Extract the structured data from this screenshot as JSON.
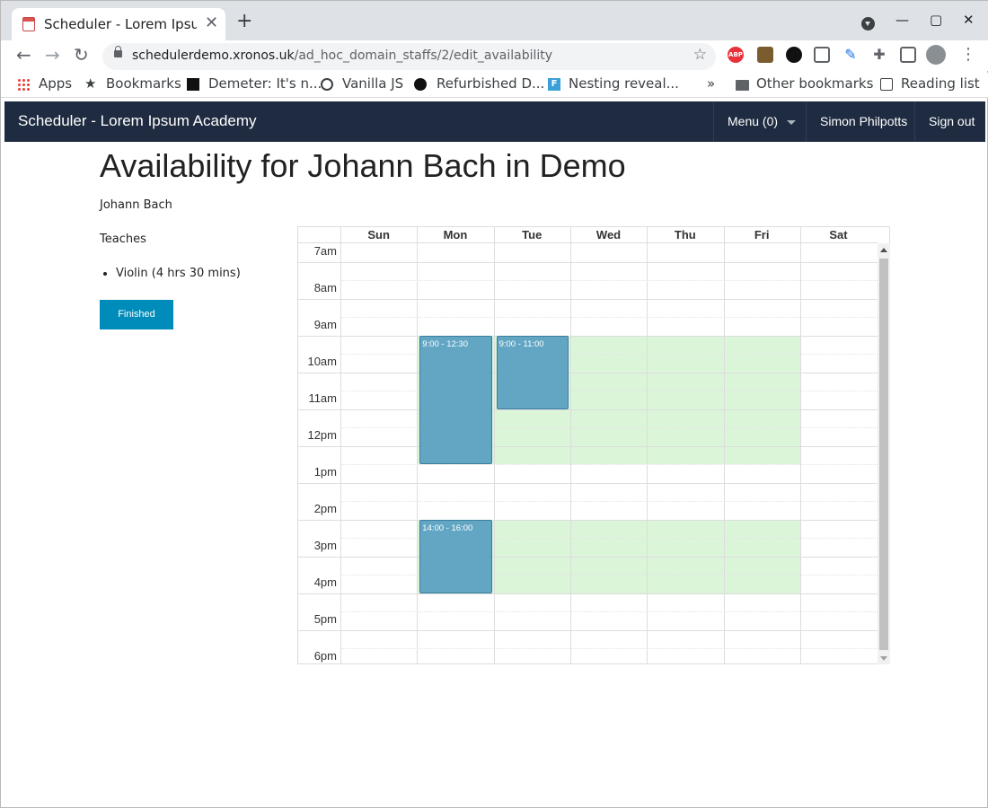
{
  "browser": {
    "tab_title": "Scheduler - Lorem Ipsum Academy",
    "tab_close": "✕",
    "new_tab": "+",
    "url_host": "schedulerdemo.xronos.uk",
    "url_path": "/ad_hoc_domain_staffs/2/edit_availability",
    "bookmarks": {
      "apps": "Apps",
      "bookmarks": "Bookmarks",
      "demeter": "Demeter: It's n...",
      "vanilla": "Vanilla JS",
      "refurbished": "Refurbished D...",
      "nesting": "Nesting reveal...",
      "more": "»",
      "other": "Other bookmarks",
      "reading": "Reading list"
    },
    "extensions": {
      "abp": "ABP"
    }
  },
  "app": {
    "brand": "Scheduler - Lorem Ipsum Academy",
    "menu": "Menu (0)",
    "user": "Simon Philpotts",
    "sign_out": "Sign out",
    "navbar_color": "#1e2b40"
  },
  "page": {
    "title": "Availability for Johann Bach in Demo",
    "staff_name": "Johann Bach",
    "teaches_label": "Teaches",
    "subjects": [
      "Violin (4 hrs 30 mins)"
    ],
    "finished_button": "Finished",
    "button_color": "#008cba"
  },
  "calendar": {
    "days": [
      "Sun",
      "Mon",
      "Tue",
      "Wed",
      "Thu",
      "Fri",
      "Sat"
    ],
    "hours": [
      "7am",
      "8am",
      "9am",
      "10am",
      "11am",
      "12pm",
      "1pm",
      "2pm",
      "3pm",
      "4pm",
      "5pm",
      "6pm"
    ],
    "availability_color": "#dbf5d9",
    "event_color": "#62a6c4",
    "availability": [
      {
        "from_day": "Mon",
        "to_day": "Fri",
        "start": "9:00",
        "end": "12:30"
      },
      {
        "from_day": "Mon",
        "to_day": "Fri",
        "start": "14:00",
        "end": "16:00"
      }
    ],
    "events": [
      {
        "day": "Mon",
        "start": "9:00",
        "end": "12:30",
        "label": "9:00 - 12:30"
      },
      {
        "day": "Tue",
        "start": "9:00",
        "end": "11:00",
        "label": "9:00 - 11:00"
      },
      {
        "day": "Mon",
        "start": "14:00",
        "end": "16:00",
        "label": "14:00 - 16:00"
      }
    ]
  }
}
